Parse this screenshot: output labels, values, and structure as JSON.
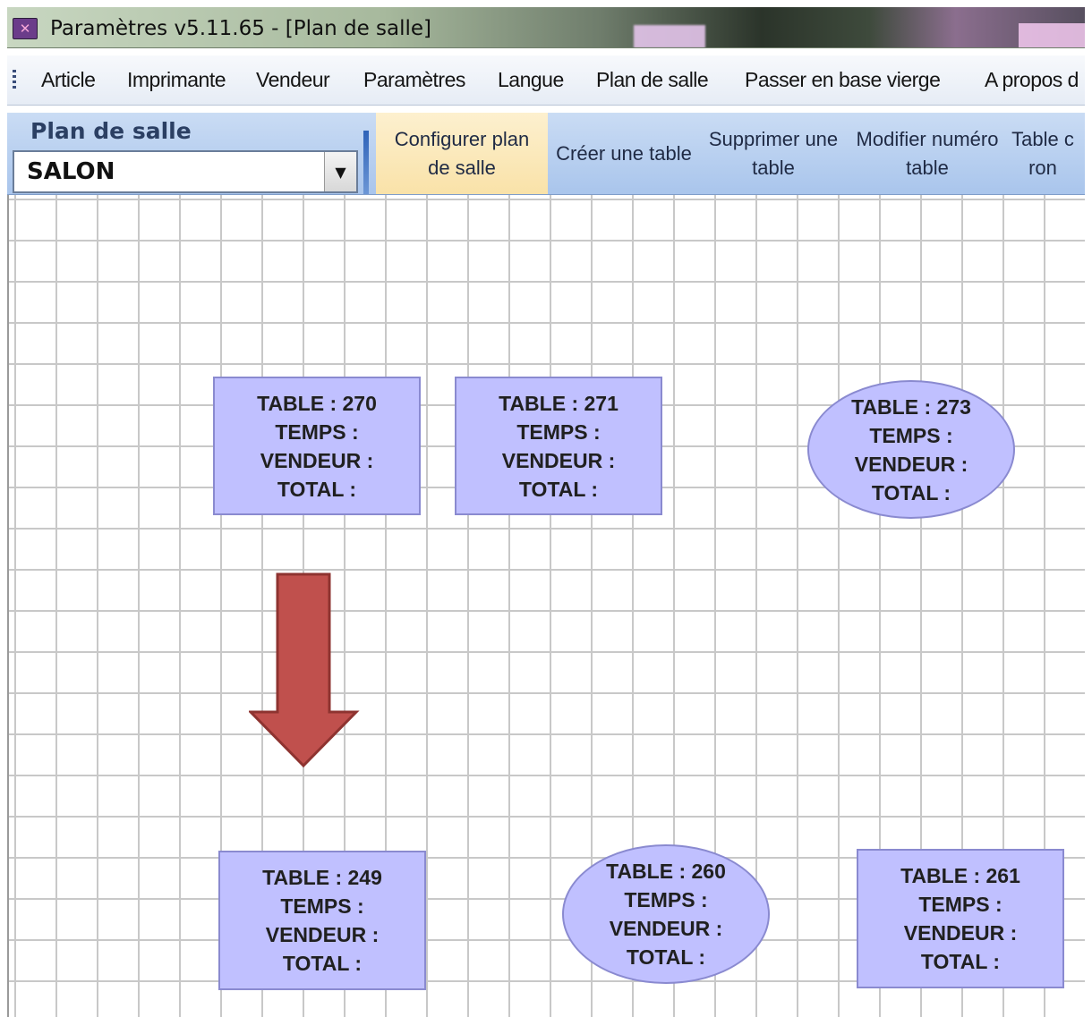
{
  "window": {
    "title": "Paramètres v5.11.65 - [Plan de salle]",
    "icon": "app-icon"
  },
  "menu": {
    "items": [
      "Article",
      "Imprimante",
      "Vendeur",
      "Paramètres",
      "Langue",
      "Plan de salle",
      "Passer en base vierge",
      "A propos d"
    ]
  },
  "toolbar": {
    "section_label": "Plan de salle",
    "room_select": {
      "value": "SALON"
    },
    "buttons": [
      {
        "label": "Configurer plan de salle",
        "active": true
      },
      {
        "label": "Créer une table",
        "active": false
      },
      {
        "label": "Supprimer une table",
        "active": false
      },
      {
        "label": "Modifier numéro table",
        "active": false
      },
      {
        "label": "Table c ron",
        "active": false
      }
    ]
  },
  "tables": [
    {
      "shape": "rect",
      "table": "TABLE : 270",
      "temps": "TEMPS :",
      "vendeur": "VENDEUR :",
      "total": "TOTAL :"
    },
    {
      "shape": "rect",
      "table": "TABLE : 271",
      "temps": "TEMPS :",
      "vendeur": "VENDEUR :",
      "total": "TOTAL :"
    },
    {
      "shape": "oval",
      "table": "TABLE : 273",
      "temps": "TEMPS :",
      "vendeur": "VENDEUR :",
      "total": "TOTAL :"
    },
    {
      "shape": "rect",
      "table": "TABLE : 249",
      "temps": "TEMPS :",
      "vendeur": "VENDEUR :",
      "total": "TOTAL :"
    },
    {
      "shape": "oval",
      "table": "TABLE : 260",
      "temps": "TEMPS :",
      "vendeur": "VENDEUR :",
      "total": "TOTAL :"
    },
    {
      "shape": "rect",
      "table": "TABLE : 261",
      "temps": "TEMPS :",
      "vendeur": "VENDEUR :",
      "total": "TOTAL :"
    }
  ],
  "colors": {
    "table_fill": "#c0c0ff",
    "table_border": "#8a8ad0",
    "arrow": "#c0504d",
    "active_button": "#f9e2a8",
    "ribbon": "#a9c5ec"
  }
}
